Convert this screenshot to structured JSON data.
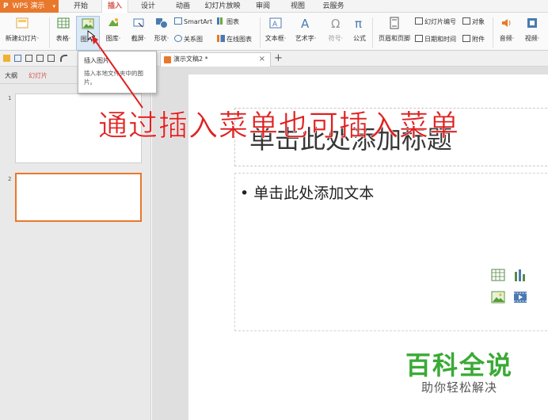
{
  "app": {
    "name": "WPS 演示",
    "logo": "P",
    "accent": "#e8782c"
  },
  "menu": {
    "items": [
      {
        "label": "开始"
      },
      {
        "label": "插入",
        "active": true
      },
      {
        "label": "设计"
      },
      {
        "label": "动画"
      },
      {
        "label": "幻灯片放映"
      },
      {
        "label": "审阅"
      },
      {
        "label": "视图"
      },
      {
        "label": "云服务"
      }
    ]
  },
  "ribbon": {
    "new_slide": "新建幻灯片·",
    "table": "表格·",
    "picture": "图片·",
    "gallery": "图库·",
    "screenshot": "截屏·",
    "shapes": "形状·",
    "relation": "关系图",
    "smartart": "SmartArt",
    "chart": "图表",
    "online_chart": "在线图表",
    "textbox": "文本框·",
    "wordart": "艺术字·",
    "symbol": "符号·",
    "formula": "公式",
    "header_footer": "页眉和页脚",
    "slide_number": "幻灯片编号",
    "datetime": "日期和时间",
    "object": "对象",
    "attachment": "附件",
    "audio": "音频·",
    "video": "视频·"
  },
  "document": {
    "tab_name": "演示文稿2 *",
    "close": "×",
    "new_tab": "+"
  },
  "leftpane": {
    "tabs": [
      {
        "label": "大纲"
      },
      {
        "label": "幻灯片",
        "active": true
      }
    ],
    "slides": [
      {
        "number": "1"
      },
      {
        "number": "2",
        "selected": true
      }
    ]
  },
  "slide": {
    "title_placeholder": "单击此处添加标题",
    "body_placeholder": "• 单击此处添加文本"
  },
  "tooltip": {
    "title": "插入图片",
    "description": "插入本地文件夹中的图片。"
  },
  "annotation": {
    "text": "通过插入菜单也可插入菜单",
    "color": "#e02020"
  },
  "watermark": {
    "main": "百科全说",
    "sub": "助你轻松解决",
    "color": "#3aaa35"
  }
}
